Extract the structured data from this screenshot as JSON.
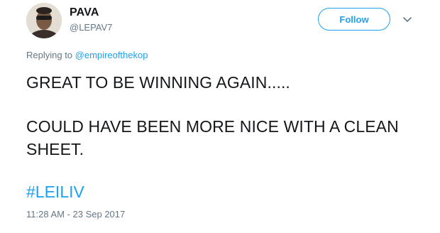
{
  "user": {
    "name": "PAVA",
    "handle": "@LEPAV7"
  },
  "follow_label": "Follow",
  "reply": {
    "prefix": "Replying to ",
    "mention": "@empireofthekop"
  },
  "tweet": {
    "line1": "GREAT TO BE WINNING AGAIN.....",
    "line2": "COULD HAVE BEEN MORE NICE WITH A CLEAN SHEET.",
    "hashtag": "#LEILIV"
  },
  "timestamp": "11:28 AM - 23 Sep 2017",
  "colors": {
    "accent": "#1da1f2",
    "secondary_text": "#657786",
    "primary_text": "#14171a"
  },
  "icons": {
    "more": "chevron-down-icon"
  }
}
